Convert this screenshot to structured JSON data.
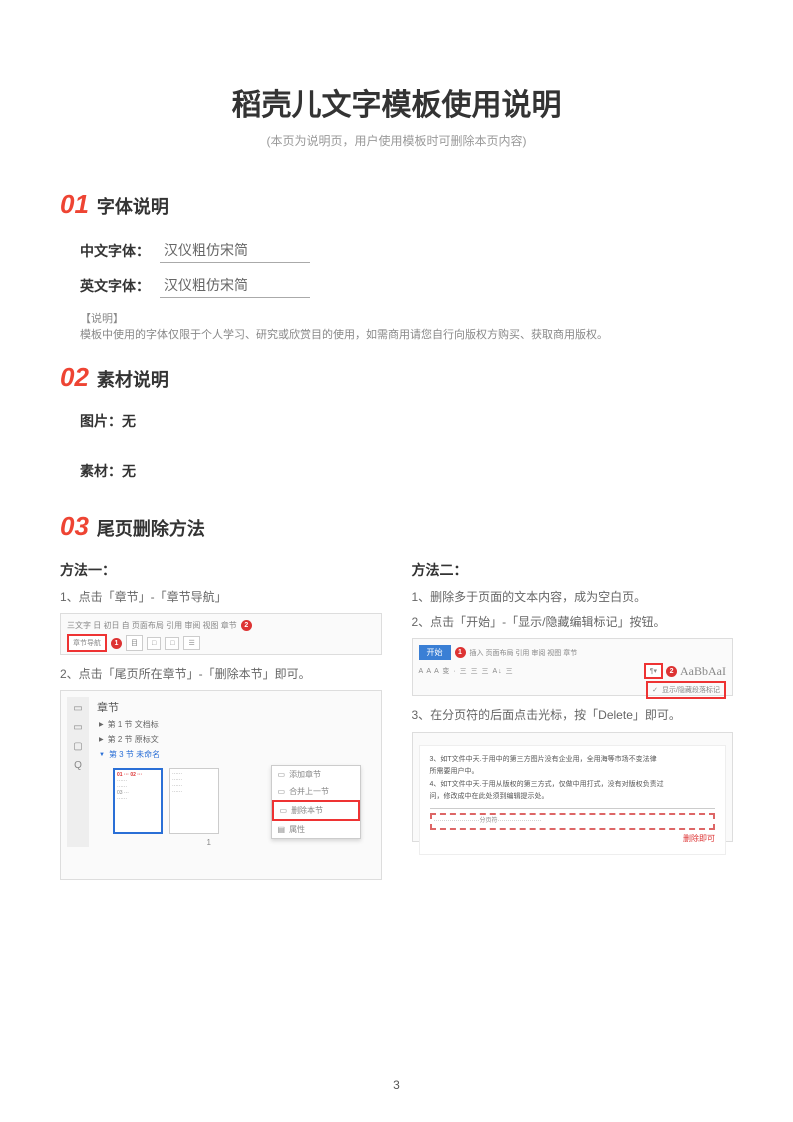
{
  "title": "稻壳儿文字模板使用说明",
  "subtitle": "(本页为说明页，用户使用模板时可删除本页内容)",
  "sections": {
    "s1": {
      "num": "01",
      "title": "字体说明"
    },
    "s2": {
      "num": "02",
      "title": "素材说明"
    },
    "s3": {
      "num": "03",
      "title": "尾页删除方法"
    }
  },
  "fonts": {
    "cn_label": "中文字体：",
    "cn_value": "汉仪粗仿宋简",
    "en_label": "英文字体：",
    "en_value": "汉仪粗仿宋简"
  },
  "note": {
    "label": "【说明】",
    "body": "模板中使用的字体仅限于个人学习、研究或欣赏目的使用，如需商用请您自行向版权方购买、获取商用版权。"
  },
  "materials": {
    "image": "图片：无",
    "asset": "素材：无"
  },
  "methods": {
    "m1": {
      "title": "方法一：",
      "step1": "1、点击「章节」-「章节导航」",
      "step2": "2、点击「尾页所在章节」-「删除本节」即可。"
    },
    "m2": {
      "title": "方法二：",
      "step1": "1、删除多于页面的文本内容，成为空白页。",
      "step2": "2、点击「开始」-「显示/隐藏编辑标记」按钮。",
      "step3": "3、在分页符的后面点击光标，按「Delete」即可。"
    }
  },
  "shot1": {
    "tabs": "三文字  日  初日  自  页面布局  引用  审阅  视图  章节",
    "highlight": "章节导航",
    "badge1": "1",
    "badge2": "2"
  },
  "shot2": {
    "panel_title": "章节",
    "items": [
      "第 1 节 文档标",
      "第 2 节 原标文",
      "第 3 节 未命名"
    ],
    "ctx": [
      "添加章节",
      "合并上一节",
      "删除本节",
      "属性"
    ],
    "thumb_num": "1"
  },
  "shot3": {
    "tab": "开始",
    "tabs_rest": "插入  页面布局  引用  审阅  视图  章节",
    "toolbar": "A  A  A  变  ·  三  三  三  A↓  三",
    "check": "显示/隐藏段落标记",
    "aa": "AaBbAaI",
    "badge1": "1",
    "badge2": "2"
  },
  "shot4": {
    "line1": "3、如T文件中天.于用中的第三方图片没有企业用，全用海等市场不变法律",
    "line2": "所需要用户中。",
    "line3": "4、如T文件中天.于用从版权的第三方式，仅做中用打式，没有对版权负责过",
    "line4": "问，修改成中在此处须到编辑提示处。",
    "pgbreak_left": "·······················分页符······················",
    "pgbreak_right": "",
    "del_hint": "删除即可"
  },
  "page_number": "3"
}
